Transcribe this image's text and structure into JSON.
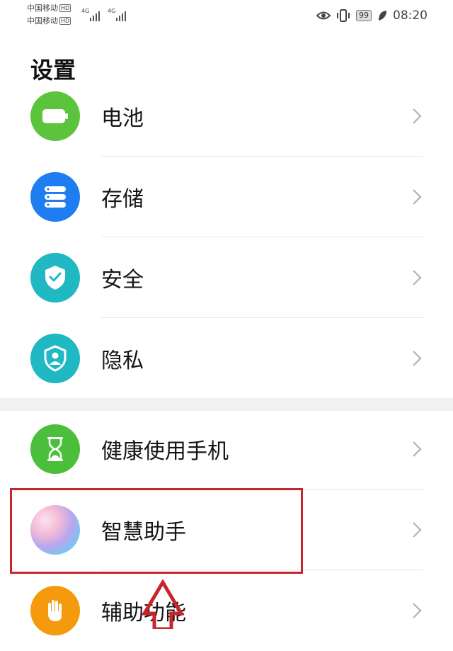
{
  "status": {
    "carrier1": "中国移动",
    "carrier2": "中国移动",
    "hd_badge": "HD",
    "network1": "4G",
    "network2": "4G",
    "battery": "99",
    "time": "08:20"
  },
  "title": "设置",
  "items": [
    {
      "label": "电池",
      "icon": "battery-icon",
      "color": "#5cc43c"
    },
    {
      "label": "存储",
      "icon": "storage-icon",
      "color": "#1e7ef1"
    },
    {
      "label": "安全",
      "icon": "shield-check-icon",
      "color": "#1fb8c3"
    },
    {
      "label": "隐私",
      "icon": "privacy-icon",
      "color": "#1fb8c3"
    },
    {
      "label": "健康使用手机",
      "icon": "hourglass-icon",
      "color": "#4bbf3b"
    },
    {
      "label": "智慧助手",
      "icon": "assistant-icon",
      "color": "#b8c8f0"
    },
    {
      "label": "辅助功能",
      "icon": "hand-icon",
      "color": "#f59a0c"
    }
  ],
  "annotation_color": "#c8252b"
}
